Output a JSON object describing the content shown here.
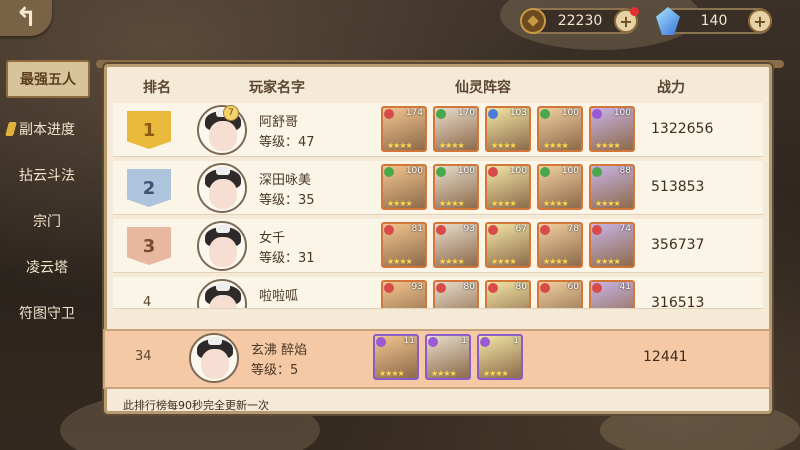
{
  "colors": {
    "accent": "#d8c49a",
    "panel": "#f4ead7",
    "self_row": "#f5c9a5"
  },
  "currency": {
    "coin_value": "22230",
    "gem_value": "140"
  },
  "sidebar": {
    "items": [
      {
        "label": "最强五人",
        "active": true
      },
      {
        "label": "副本进度",
        "marked": true
      },
      {
        "label": "拈云斗法"
      },
      {
        "label": "宗门"
      },
      {
        "label": "凌云塔"
      },
      {
        "label": "符图守卫"
      }
    ]
  },
  "table": {
    "headers": {
      "rank": "排名",
      "player": "玩家名字",
      "team": "仙灵阵容",
      "power": "战力"
    },
    "rows": [
      {
        "rank": "1",
        "name": "阿舒哥",
        "level": "等级：47",
        "avatar_badge": "7",
        "power": "1322656",
        "team": [
          {
            "lv": "174",
            "ele": "red"
          },
          {
            "lv": "170",
            "ele": "green"
          },
          {
            "lv": "103",
            "ele": "blue"
          },
          {
            "lv": "100",
            "ele": "green"
          },
          {
            "lv": "100",
            "ele": "purple"
          }
        ]
      },
      {
        "rank": "2",
        "name": "深田咏美",
        "level": "等级：35",
        "power": "513853",
        "team": [
          {
            "lv": "100",
            "ele": "green"
          },
          {
            "lv": "100",
            "ele": "green"
          },
          {
            "lv": "100",
            "ele": "red"
          },
          {
            "lv": "100",
            "ele": "green"
          },
          {
            "lv": "88",
            "ele": "green"
          }
        ]
      },
      {
        "rank": "3",
        "name": "女千",
        "level": "等级：31",
        "power": "356737",
        "team": [
          {
            "lv": "81",
            "ele": "red"
          },
          {
            "lv": "93",
            "ele": "red"
          },
          {
            "lv": "67",
            "ele": "red"
          },
          {
            "lv": "78",
            "ele": "red"
          },
          {
            "lv": "74",
            "ele": "red"
          }
        ]
      },
      {
        "rank": "4",
        "name": "啦啦呱",
        "level": "",
        "power": "316513",
        "team": [
          {
            "lv": "93",
            "ele": "red"
          },
          {
            "lv": "80",
            "ele": "red"
          },
          {
            "lv": "80",
            "ele": "red"
          },
          {
            "lv": "60",
            "ele": "red"
          },
          {
            "lv": "41",
            "ele": "red"
          }
        ]
      }
    ],
    "self_row": {
      "rank": "34",
      "name": "玄沸 醉焰",
      "level": "等级：5",
      "power": "12441",
      "team": [
        {
          "lv": "11",
          "ele": "purple"
        },
        {
          "lv": "1",
          "ele": "purple"
        },
        {
          "lv": "1",
          "ele": "purple"
        }
      ]
    },
    "footer_note": "此排行榜每90秒完全更新一次"
  }
}
